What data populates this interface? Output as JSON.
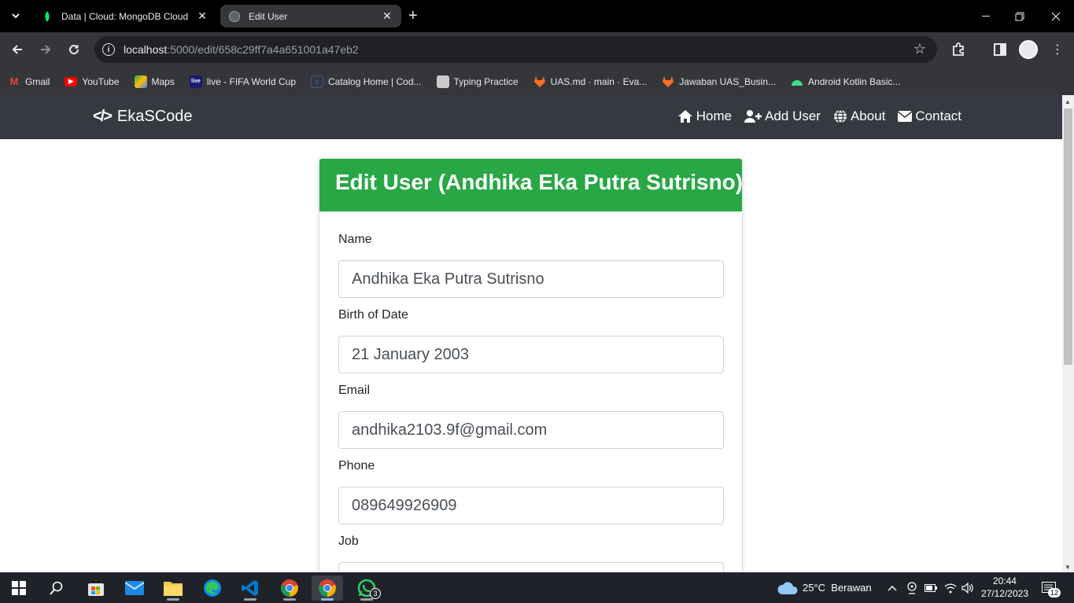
{
  "browser": {
    "tabs": [
      {
        "title": "Data | Cloud: MongoDB Cloud",
        "active": false
      },
      {
        "title": "Edit User",
        "active": true
      }
    ],
    "url_host": "localhost",
    "url_path": ":5000/edit/658c29ff7a4a651001a47eb2",
    "bookmarks": [
      {
        "label": "Gmail",
        "icon": "gmail-icon",
        "color": "#ea4335"
      },
      {
        "label": "YouTube",
        "icon": "youtube-icon",
        "color": "#ff0000"
      },
      {
        "label": "Maps",
        "icon": "maps-icon",
        "color": "#34a853"
      },
      {
        "label": "live - FIFA World Cup",
        "icon": "live-icon",
        "color": "#1a1a6e"
      },
      {
        "label": "Catalog Home | Cod...",
        "icon": "catalog-icon",
        "color": "#3b5998"
      },
      {
        "label": "Typing Practice",
        "icon": "typing-icon",
        "color": "#cccccc"
      },
      {
        "label": "UAS.md · main · Eva...",
        "icon": "gitlab-icon",
        "color": "#fc6d26"
      },
      {
        "label": "Jawaban UAS_Busin...",
        "icon": "gitlab-icon",
        "color": "#fc6d26"
      },
      {
        "label": "Android Kotlin Basic...",
        "icon": "android-icon",
        "color": "#3ddc84"
      }
    ]
  },
  "navbar": {
    "brand": "EkaSCode",
    "links": [
      {
        "label": "Home",
        "icon": "home-icon"
      },
      {
        "label": "Add User",
        "icon": "user-plus-icon"
      },
      {
        "label": "About",
        "icon": "globe-icon"
      },
      {
        "label": "Contact",
        "icon": "envelope-icon"
      }
    ]
  },
  "card": {
    "title": "Edit User (Andhika Eka Putra Sutrisno)",
    "header_color": "#28a745",
    "fields": [
      {
        "label": "Name",
        "value": "Andhika Eka Putra Sutrisno"
      },
      {
        "label": "Birth of Date",
        "value": "21 January 2003"
      },
      {
        "label": "Email",
        "value": "andhika2103.9f@gmail.com"
      },
      {
        "label": "Phone",
        "value": "089649926909"
      },
      {
        "label": "Job",
        "value": ""
      }
    ]
  },
  "taskbar": {
    "weather": "25°C  Berawan",
    "time": "20:44",
    "date": "27/12/2023",
    "notifications": "12",
    "whatsapp_badge": "3"
  }
}
